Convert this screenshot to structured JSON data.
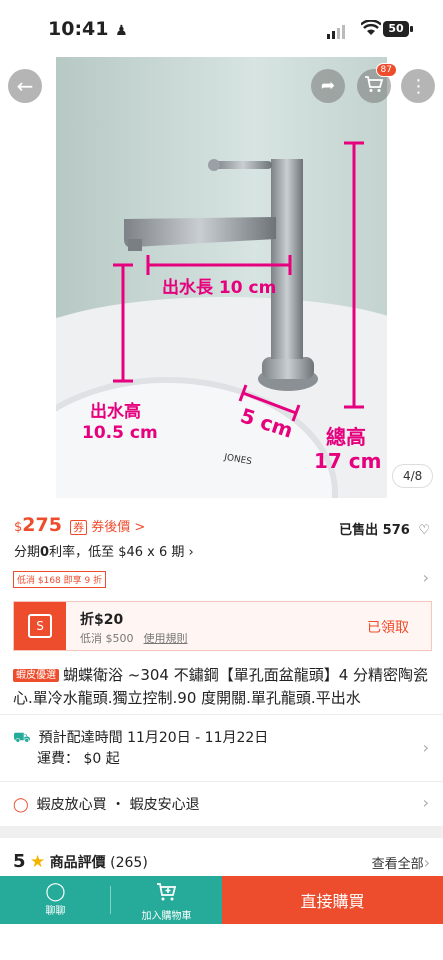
{
  "status_bar": {
    "time": "10:41",
    "battery": "50"
  },
  "gallery": {
    "page_indicator": "4/8",
    "cart_count": "87",
    "annotations": {
      "spout_length": "出水長 10 cm",
      "spout_height_label": "出水高",
      "spout_height_value": "10.5 cm",
      "base_width": "5 cm",
      "total_height_label": "總高",
      "total_height_value": "17 cm",
      "brand": "JONES"
    },
    "icons": {
      "back": "back-arrow-icon",
      "share": "share-icon",
      "cart": "cart-icon",
      "more": "more-icon"
    }
  },
  "price": {
    "currency": "$",
    "amount": "275",
    "coupon_label": "券後價 >",
    "sold_label": "已售出 576"
  },
  "installment": {
    "prefix": "分期",
    "rate_bold": "0",
    "rate": "利率，低至 $46 x 6 期 ›"
  },
  "deal_tag": "低消 $168 即享 9 折",
  "voucher": {
    "title": "折$20",
    "min_spend": "低消 $500",
    "rules": "使用規則",
    "status": "已領取"
  },
  "product": {
    "badge": "蝦皮優選",
    "title": "蝴蝶衛浴 ~304 不鏽鋼【單孔面盆龍頭】4 分精密陶瓷心.單冷水龍頭.獨立控制.90 度開關.單孔龍頭.平出水"
  },
  "shipping": {
    "line1": "預計配達時間 11月20日 - 11月22日",
    "line2": "運費： $0 起"
  },
  "guarantee": "蝦皮放心買 ・ 蝦皮安心退",
  "rating": {
    "score": "5",
    "label": "商品評價",
    "count": "(265)",
    "see_all": "查看全部"
  },
  "bottom_bar": {
    "chat": "聊聊",
    "add_cart": "加入購物車",
    "buy_now": "直接購買"
  },
  "colors": {
    "brand": "#ee4d2d",
    "teal": "#26aa99",
    "annotation": "#e6007e"
  }
}
